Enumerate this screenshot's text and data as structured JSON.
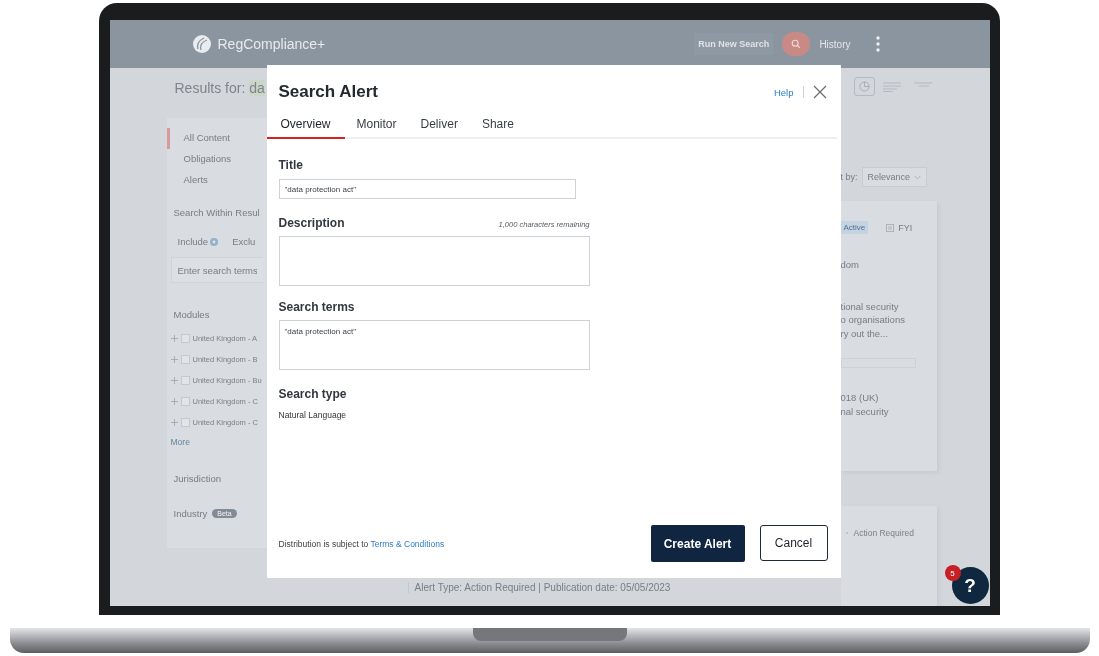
{
  "header": {
    "logo": "RegCompliance+",
    "run_new_search": "Run New Search",
    "history": "History"
  },
  "results_heading": {
    "label": "Results for:",
    "query": "da"
  },
  "sidebar": {
    "content_types": [
      {
        "label": "All Content",
        "selected": true
      },
      {
        "label": "Obligations",
        "selected": false
      },
      {
        "label": "Alerts",
        "selected": false
      }
    ],
    "search_within": "Search Within Resul",
    "include": "Include",
    "exclude": "Exclu",
    "search_field": {
      "placeholder": "Enter search terms"
    },
    "modules_heading": "Modules",
    "modules": [
      {
        "label": "United Kingdom - A",
        "checked": false
      },
      {
        "label": "United Kingdom - B",
        "checked": false
      },
      {
        "label": "United Kingdom - Bu",
        "checked": false
      },
      {
        "label": "United Kingdom - C",
        "checked": false
      },
      {
        "label": "United Kingdom - C",
        "checked": false
      }
    ],
    "more": "More",
    "jurisdiction": "Jurisdiction",
    "industry": "Industry",
    "industry_badge": "Beta"
  },
  "view_modes": [
    {
      "kind": "chart",
      "selected": true
    },
    {
      "kind": "list",
      "selected": false
    },
    {
      "kind": "compact",
      "selected": false
    }
  ],
  "results": {
    "sort_label": "t by:",
    "sort_value": "Relevance",
    "cards": [
      {
        "status": "Active",
        "type": "FYI",
        "lines": [
          "dom"
        ],
        "summary": [
          "tional security",
          "o organisations",
          "ry out the..."
        ],
        "related": [
          "018 (UK)",
          "nal security"
        ]
      },
      {
        "status": "Action Required"
      }
    ],
    "meta": "Alert Type: Action Required | Publication date: 05/05/2023"
  },
  "help_widget": {
    "label": "?",
    "badge": "5"
  },
  "modal": {
    "title": "Search Alert",
    "help": "Help",
    "tabs": [
      {
        "label": "Overview",
        "selected": true
      },
      {
        "label": "Monitor",
        "selected": false
      },
      {
        "label": "Deliver",
        "selected": false
      },
      {
        "label": "Share",
        "selected": false
      }
    ],
    "fields": [
      {
        "kind": "input",
        "label": "Title",
        "value": "\"data protection act\""
      },
      {
        "kind": "textarea",
        "label": "Description",
        "counter": "1,000 characters remaining"
      },
      {
        "kind": "textarea",
        "label": "Search terms",
        "value": "\"data protection act\""
      },
      {
        "kind": "text",
        "label": "Search type",
        "value": "Natural Language"
      }
    ],
    "footer": {
      "text": "Distribution is subject to",
      "link": "Terms & Conditions"
    },
    "buttons": [
      {
        "kind": "primary",
        "label": "Create Alert"
      },
      {
        "kind": "secondary",
        "label": "Cancel"
      }
    ]
  }
}
